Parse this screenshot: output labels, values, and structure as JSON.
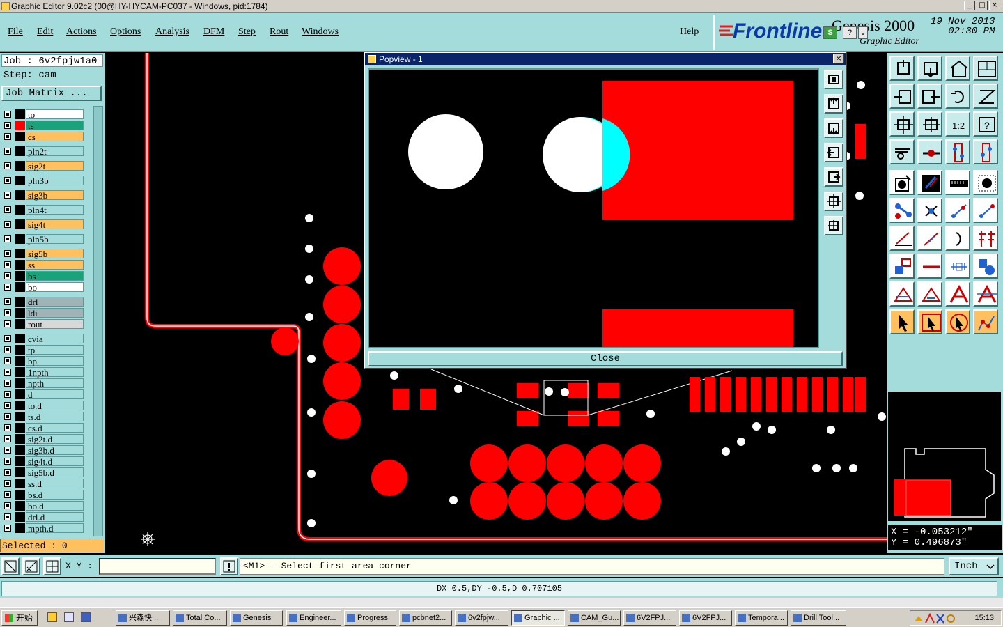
{
  "window": {
    "title": "Graphic Editor 9.02c2 (00@HY-HYCAM-PC037 - Windows, pid:1784)",
    "controls": [
      "_",
      "□",
      "×"
    ]
  },
  "menu": {
    "items": [
      "File",
      "Edit",
      "Actions",
      "Options",
      "Analysis",
      "DFM",
      "Step",
      "Rout",
      "Windows"
    ],
    "help": "Help"
  },
  "brand": {
    "logo_text": "Frontline",
    "product": "Genesis 2000",
    "subtitle": "Graphic Editor",
    "date": "19  Nov  2013",
    "time": "02:30  PM",
    "mini_buttons": [
      "S",
      "?",
      "⌄"
    ]
  },
  "job": {
    "job_line": "Job  :  6v2fpjw1a0",
    "step_line": "Step:  cam",
    "job_matrix": "Job Matrix ..."
  },
  "layers": [
    {
      "name": "to",
      "color": "#ffffff",
      "swatch": "#000000"
    },
    {
      "name": "ts",
      "color": "#1aa37a",
      "swatch": "#ff0000",
      "selected": true
    },
    {
      "name": "cs",
      "color": "#ffc060",
      "swatch": "#000000"
    },
    {
      "name": "pln2t",
      "color": "#a4dcdc",
      "swatch": "#000000"
    },
    {
      "name": "sig2t",
      "color": "#ffc060",
      "swatch": "#000000"
    },
    {
      "name": "pln3b",
      "color": "#a4dcdc",
      "swatch": "#000000"
    },
    {
      "name": "sig3b",
      "color": "#ffc060",
      "swatch": "#000000"
    },
    {
      "name": "pln4t",
      "color": "#a4dcdc",
      "swatch": "#000000"
    },
    {
      "name": "sig4t",
      "color": "#ffc060",
      "swatch": "#000000"
    },
    {
      "name": "pln5b",
      "color": "#a4dcdc",
      "swatch": "#000000"
    },
    {
      "name": "sig5b",
      "color": "#ffc060",
      "swatch": "#000000"
    },
    {
      "name": "ss",
      "color": "#ffc060",
      "swatch": "#000000"
    },
    {
      "name": "bs",
      "color": "#1aa37a",
      "swatch": "#000000"
    },
    {
      "name": "bo",
      "color": "#ffffff",
      "swatch": "#000000"
    },
    {
      "name": "drl",
      "color": "#a0b4b8",
      "swatch": "#000000"
    },
    {
      "name": "ldi",
      "color": "#a0b4b8",
      "swatch": "#000000"
    },
    {
      "name": "rout",
      "color": "#d8d8d8",
      "swatch": "#000000"
    },
    {
      "name": "cvia",
      "color": "#a4dcdc",
      "swatch": "#000000"
    },
    {
      "name": "tp",
      "color": "#a4dcdc",
      "swatch": "#000000"
    },
    {
      "name": "bp",
      "color": "#a4dcdc",
      "swatch": "#000000"
    },
    {
      "name": "1npth",
      "color": "#a4dcdc",
      "swatch": "#000000"
    },
    {
      "name": "npth",
      "color": "#a4dcdc",
      "swatch": "#000000"
    },
    {
      "name": "d",
      "color": "#a4dcdc",
      "swatch": "#000000"
    },
    {
      "name": "to.d",
      "color": "#a4dcdc",
      "swatch": "#000000"
    },
    {
      "name": "ts.d",
      "color": "#a4dcdc",
      "swatch": "#000000"
    },
    {
      "name": "cs.d",
      "color": "#a4dcdc",
      "swatch": "#000000"
    },
    {
      "name": "sig2t.d",
      "color": "#a4dcdc",
      "swatch": "#000000"
    },
    {
      "name": "sig3b.d",
      "color": "#a4dcdc",
      "swatch": "#000000"
    },
    {
      "name": "sig4t.d",
      "color": "#a4dcdc",
      "swatch": "#000000"
    },
    {
      "name": "sig5b.d",
      "color": "#a4dcdc",
      "swatch": "#000000"
    },
    {
      "name": "ss.d",
      "color": "#a4dcdc",
      "swatch": "#000000"
    },
    {
      "name": "bs.d",
      "color": "#a4dcdc",
      "swatch": "#000000"
    },
    {
      "name": "bo.d",
      "color": "#a4dcdc",
      "swatch": "#000000"
    },
    {
      "name": "drl.d",
      "color": "#a4dcdc",
      "swatch": "#000000"
    },
    {
      "name": "mpth.d",
      "color": "#a4dcdc",
      "swatch": "#000000"
    }
  ],
  "selected_label": "Selected : 0",
  "popview": {
    "title": "Popview - 1",
    "close_label": "Close",
    "side_buttons": [
      "zoom-home-icon",
      "pan-up-icon",
      "pan-down-icon",
      "pan-left-icon",
      "pan-right-icon",
      "zoom-in-icon",
      "zoom-out-icon"
    ]
  },
  "tools": [
    "fit-screen-icon",
    "fit-down-icon",
    "home-icon",
    "window-icon",
    "pan-left-icon",
    "pan-right-icon",
    "undo-icon",
    "redraw-icon",
    "zoom-fit-icon",
    "zoom-center-icon",
    "scale-1to2-icon",
    "help-icon",
    "measure-icon",
    "snap-icon",
    "layers-compare-icon",
    "layers-swap-icon",
    "pad-icon",
    "line-icon",
    "ruler-icon",
    "circle-icon",
    "node-icon",
    "cross-icon",
    "connect-icon",
    "connect2-icon",
    "angle-icon",
    "slash-icon",
    "arc-icon",
    "flip-icon",
    "copy-icon",
    "minus-icon",
    "dimension-icon",
    "group-icon",
    "triangle-icon",
    "triangle2-icon",
    "letter-a-icon",
    "letter-a2-icon",
    "select-arrow-icon",
    "select-box-icon",
    "select-circle-icon",
    "select-path-icon"
  ],
  "coords": {
    "x": "X  =  -0.053212\"",
    "y": "Y  =  0.496873\""
  },
  "command": {
    "xy_label": "X Y :",
    "xy_value": "",
    "prompt": "<M1> - Select first area corner",
    "units": "Inch"
  },
  "status": {
    "measure": "DX=0.5,DY=-0.5,D=0.707105"
  },
  "taskbar": {
    "start": "开始",
    "tasks": [
      "兴森快...",
      "Total Co...",
      "Genesis",
      "Engineer...",
      "Progress",
      "pcbnet2...",
      "6v2fpjw...",
      "Graphic ...",
      "CAM_Gu...",
      "6V2FPJ...",
      "6V2FPJ...",
      "Tempora...",
      "Drill Tool..."
    ],
    "active_task": "Graphic ...",
    "clock": "15:13"
  },
  "colors": {
    "panel": "#a4dcdc",
    "copper": "#ff0000",
    "highlight": "#00ffff",
    "orange": "#ffc060",
    "selected_green": "#1aa37a"
  }
}
